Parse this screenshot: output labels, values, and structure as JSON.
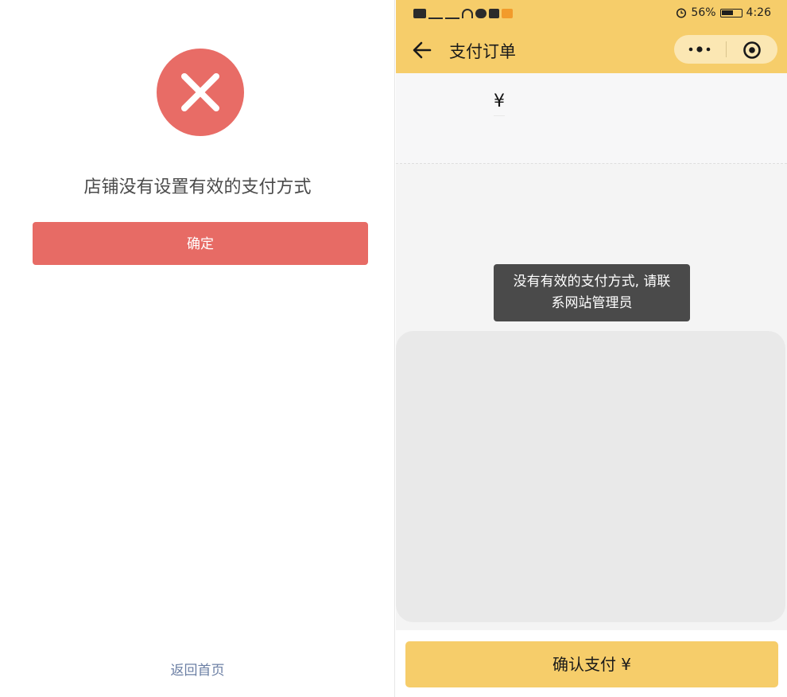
{
  "left_panel": {
    "error_icon": "close-x-icon",
    "message": "店铺没有设置有效的支付方式",
    "confirm_label": "确定",
    "home_link": "返回首页",
    "colors": {
      "error_red": "#e86c66",
      "link_blue": "#6b7fa4"
    }
  },
  "phone": {
    "statusbar": {
      "battery_percent": "56%",
      "time": "4:26",
      "icons": [
        "hd-icon",
        "signal-4g-icon",
        "signal-4g-icon",
        "wifi-icon",
        "chat-icon",
        "tiktok-icon",
        "mail-icon",
        "alarm-icon",
        "battery-icon"
      ]
    },
    "navbar": {
      "title": "支付订单",
      "back_icon": "back-arrow-icon",
      "more_icon": "more-dots-icon",
      "close_icon": "target-circle-icon"
    },
    "amount_symbol": "¥",
    "toast": {
      "message": "没有有效的支付方式, 请联系网站管理员"
    },
    "pay_button_label": "确认支付 ¥",
    "colors": {
      "accent_yellow": "#f6cd6a",
      "toast_bg": "#4a4a4a"
    }
  }
}
